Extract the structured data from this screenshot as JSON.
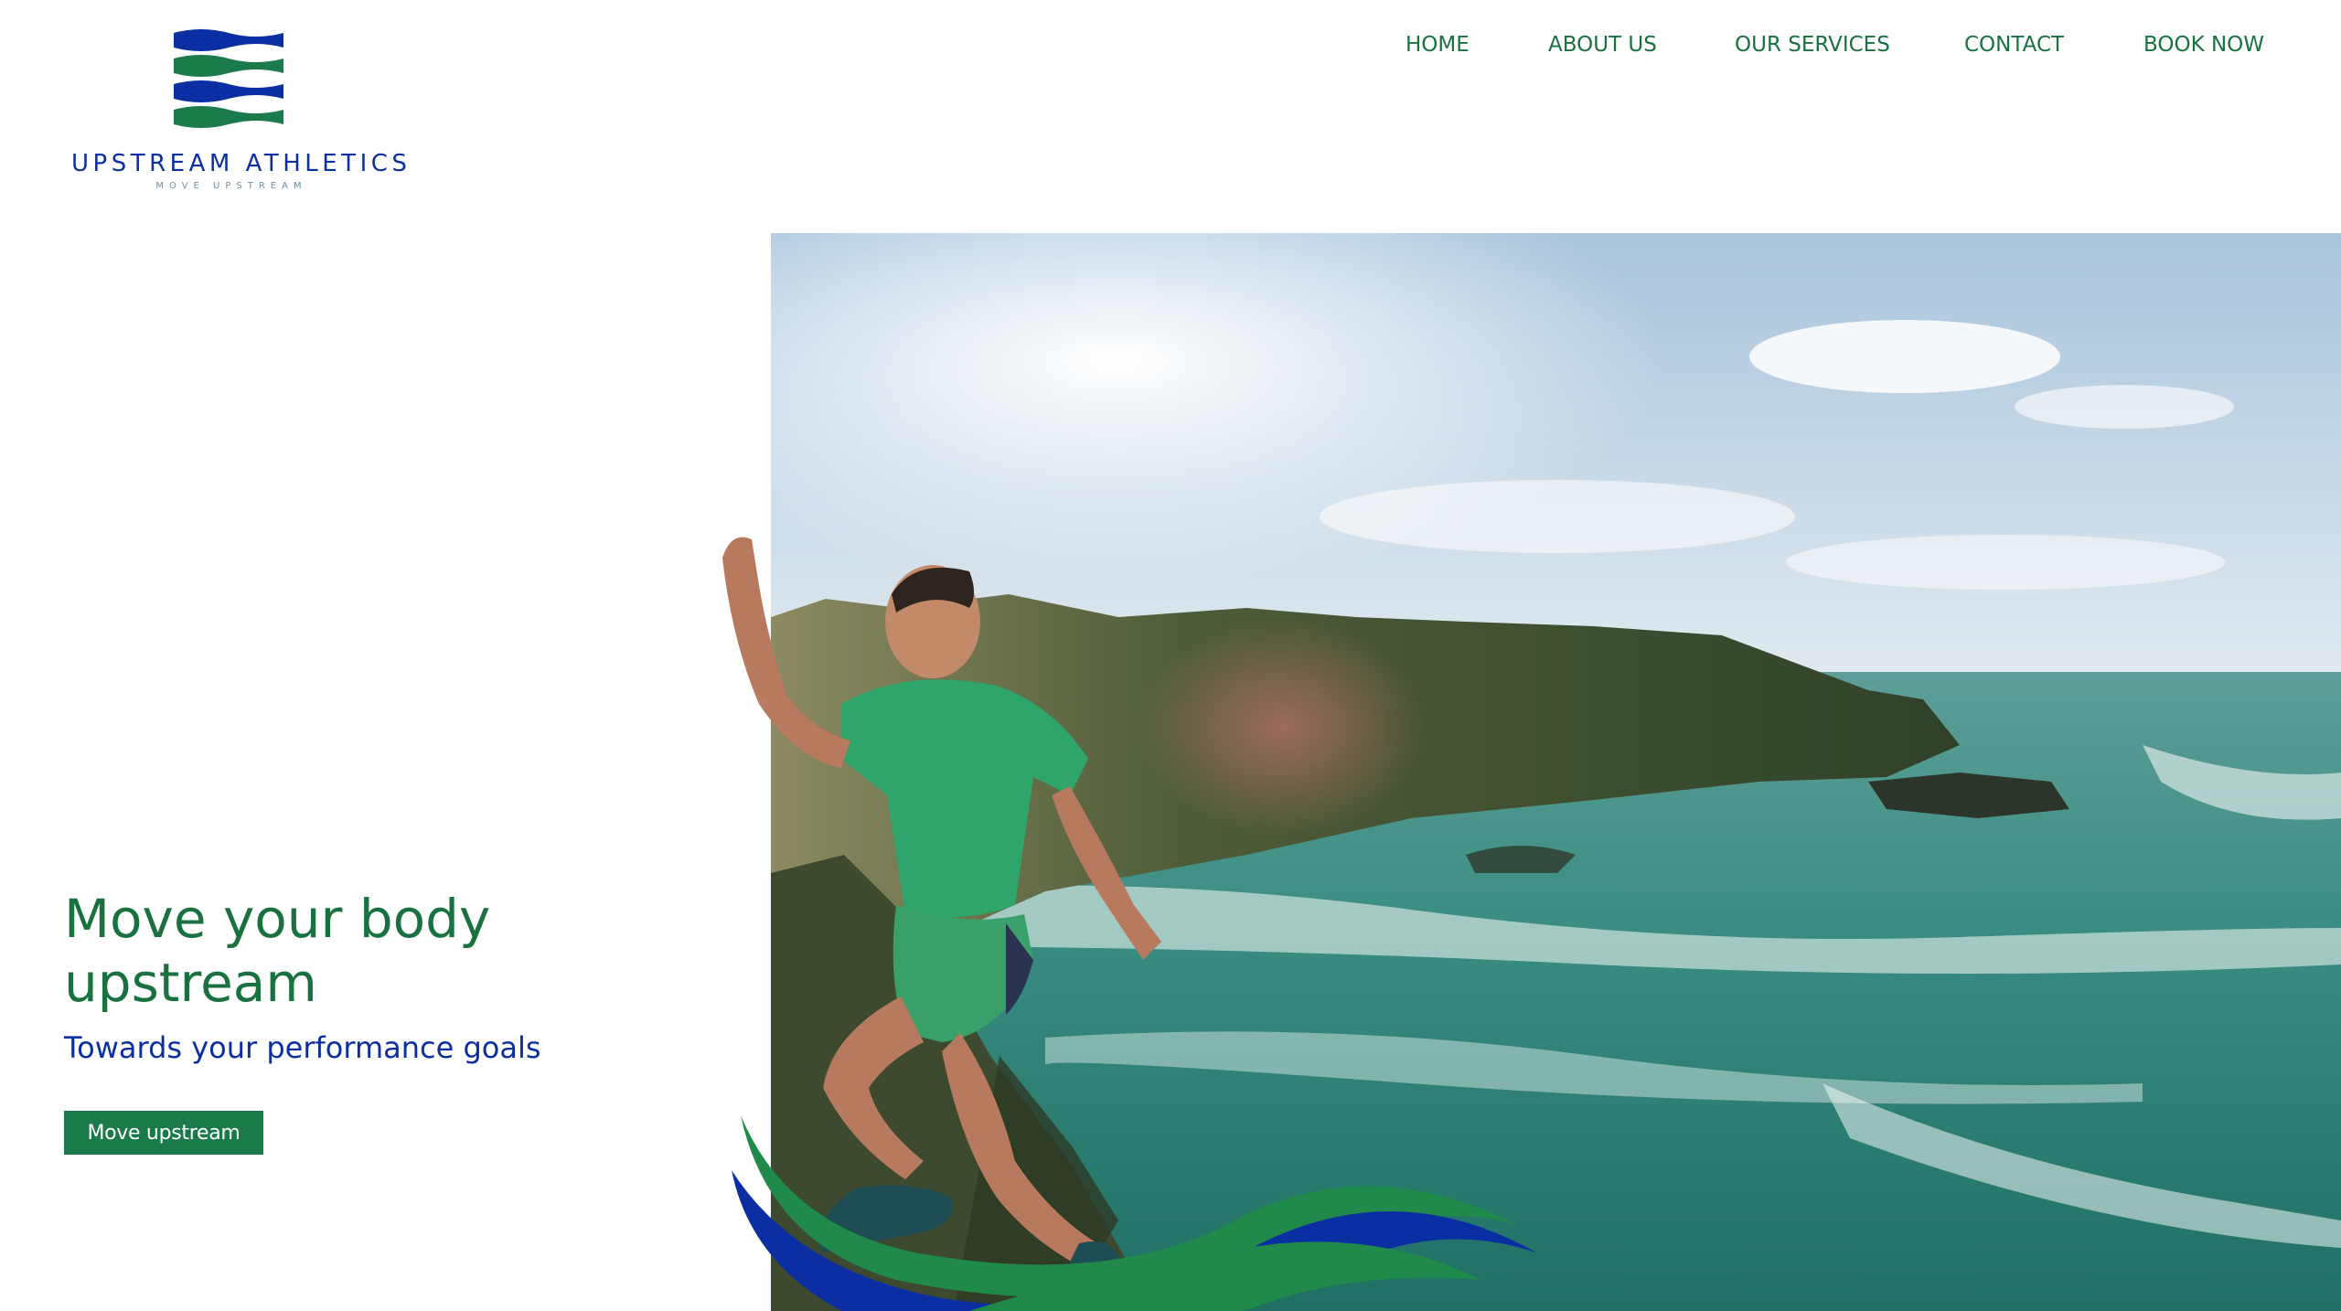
{
  "brand": {
    "name": "UPSTREAM ATHLETICS",
    "tagline": "MOVE UPSTREAM"
  },
  "nav": {
    "items": [
      {
        "label": "HOME"
      },
      {
        "label": "ABOUT US"
      },
      {
        "label": "OUR SERVICES"
      },
      {
        "label": "CONTACT"
      },
      {
        "label": "BOOK NOW"
      }
    ]
  },
  "hero": {
    "headline": "Move your body upstream",
    "subheadline": "Towards your performance goals",
    "cta_label": "Move upstream"
  },
  "colors": {
    "brand_green": "#1a7140",
    "brand_blue": "#0b2fa3",
    "button_green": "#1a7a4a",
    "nav_text": "#1a7140"
  },
  "icons": {
    "logo_mark": "wave-stripes-icon"
  }
}
